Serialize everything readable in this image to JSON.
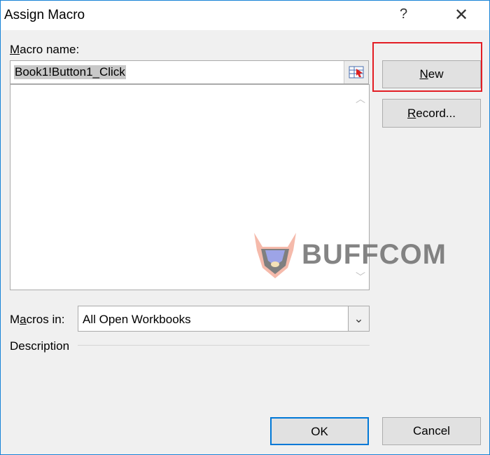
{
  "dialog": {
    "title": "Assign Macro",
    "help": "?",
    "close": "✕"
  },
  "macro_name": {
    "label_accel": "M",
    "label_rest": "acro name:",
    "value": "Book1!Button1_Click",
    "items": []
  },
  "buttons": {
    "new_accel": "N",
    "new_rest": "ew",
    "record_accel": "R",
    "record_rest": "ecord...",
    "ok": "OK",
    "cancel": "Cancel"
  },
  "macros_in": {
    "label_pre": "M",
    "label_accel": "a",
    "label_rest": "cros in:",
    "value": "All Open Workbooks"
  },
  "description": {
    "label": "Description"
  },
  "watermark": {
    "text": "BUFFCOM"
  },
  "colors": {
    "highlight": "#e31d24",
    "accent": "#1883d7"
  }
}
